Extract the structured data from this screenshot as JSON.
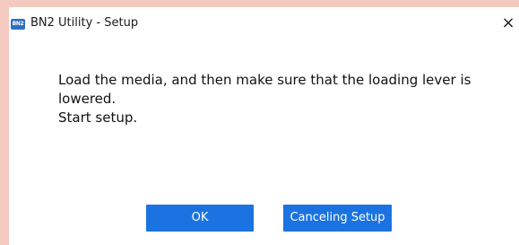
{
  "window": {
    "title": "BN2 Utility - Setup",
    "app_icon_text": "BN2",
    "close_glyph": "×"
  },
  "message": {
    "line1": "Load the media, and then make sure that the loading lever is",
    "line2": "lowered.",
    "line3": "Start setup."
  },
  "buttons": {
    "ok_label": "OK",
    "cancel_label": "Canceling Setup"
  },
  "colors": {
    "desktop_background": "#f3c9c0",
    "button_accent": "#1a73e0",
    "app_icon": "#2f6fc7"
  },
  "icons": {
    "app": "app-icon",
    "close": "close-icon"
  }
}
